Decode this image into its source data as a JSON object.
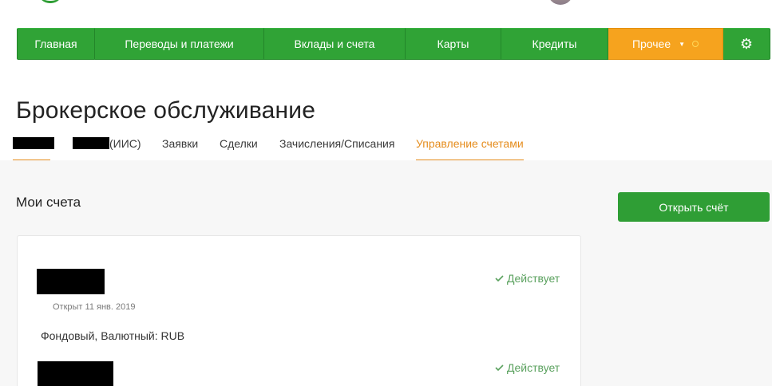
{
  "nav": {
    "items": [
      {
        "label": "Главная"
      },
      {
        "label": "Переводы и платежи"
      },
      {
        "label": "Вклады и счета"
      },
      {
        "label": "Карты"
      },
      {
        "label": "Кредиты"
      },
      {
        "label": "Прочее"
      }
    ]
  },
  "page": {
    "title": "Брокерское обслуживание"
  },
  "tabs": [
    {
      "label": ""
    },
    {
      "label": "(ИИС)"
    },
    {
      "label": "Заявки"
    },
    {
      "label": "Сделки"
    },
    {
      "label": "Зачисления/Списания"
    },
    {
      "label": "Управление счетами"
    }
  ],
  "section": {
    "title": "Мои счета",
    "open_button": "Открыть счёт"
  },
  "accounts": [
    {
      "status": "Действует",
      "opened": "Открыт 11 янв. 2019",
      "type": "Фондовый, Валютный: RUB"
    },
    {
      "status": "Действует"
    }
  ],
  "colors": {
    "brand_green": "#30a336",
    "accent_orange": "#f6a31e",
    "active_tab": "#e58c1c",
    "status_green": "#5aa15e"
  }
}
